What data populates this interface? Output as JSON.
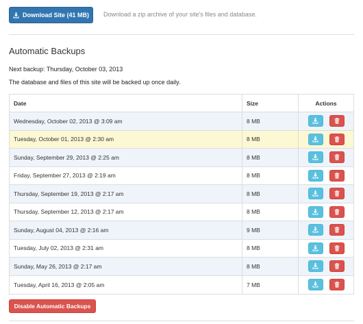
{
  "download": {
    "button_label": "Download Site (41 MB)",
    "description": "Download a zip archive of your site's files and database."
  },
  "backups": {
    "title": "Automatic Backups",
    "next_backup": "Next backup: Thursday, October 03, 2013",
    "schedule_text": "The database and files of this site will be backed up once daily.",
    "columns": {
      "date": "Date",
      "size": "Size",
      "actions": "Actions"
    },
    "rows": [
      {
        "date": "Wednesday, October 02, 2013 @ 3:09 am",
        "size": "8 MB"
      },
      {
        "date": "Tuesday, October 01, 2013 @ 2:30 am",
        "size": "8 MB"
      },
      {
        "date": "Sunday, September 29, 2013 @ 2:25 am",
        "size": "8 MB"
      },
      {
        "date": "Friday, September 27, 2013 @ 2:19 am",
        "size": "8 MB"
      },
      {
        "date": "Thursday, September 19, 2013 @ 2:17 am",
        "size": "8 MB"
      },
      {
        "date": "Thursday, September 12, 2013 @ 2:17 am",
        "size": "8 MB"
      },
      {
        "date": "Sunday, August 04, 2013 @ 2:16 am",
        "size": "9 MB"
      },
      {
        "date": "Tuesday, July 02, 2013 @ 2:31 am",
        "size": "8 MB"
      },
      {
        "date": "Sunday, May 26, 2013 @ 2:17 am",
        "size": "8 MB"
      },
      {
        "date": "Tuesday, April 16, 2013 @ 2:05 am",
        "size": "7 MB"
      }
    ],
    "highlighted_row_index": 1,
    "disable_button_label": "Disable Automatic Backups"
  },
  "icons": {
    "download_button_icon": "download-icon",
    "row_download_icon": "download-icon",
    "row_delete_icon": "trash-icon"
  },
  "colors": {
    "primary": "#3276b1",
    "info": "#5bc0de",
    "danger": "#d9534f",
    "highlight_row": "#fcf8d3",
    "striped_row": "#eef4fa"
  }
}
